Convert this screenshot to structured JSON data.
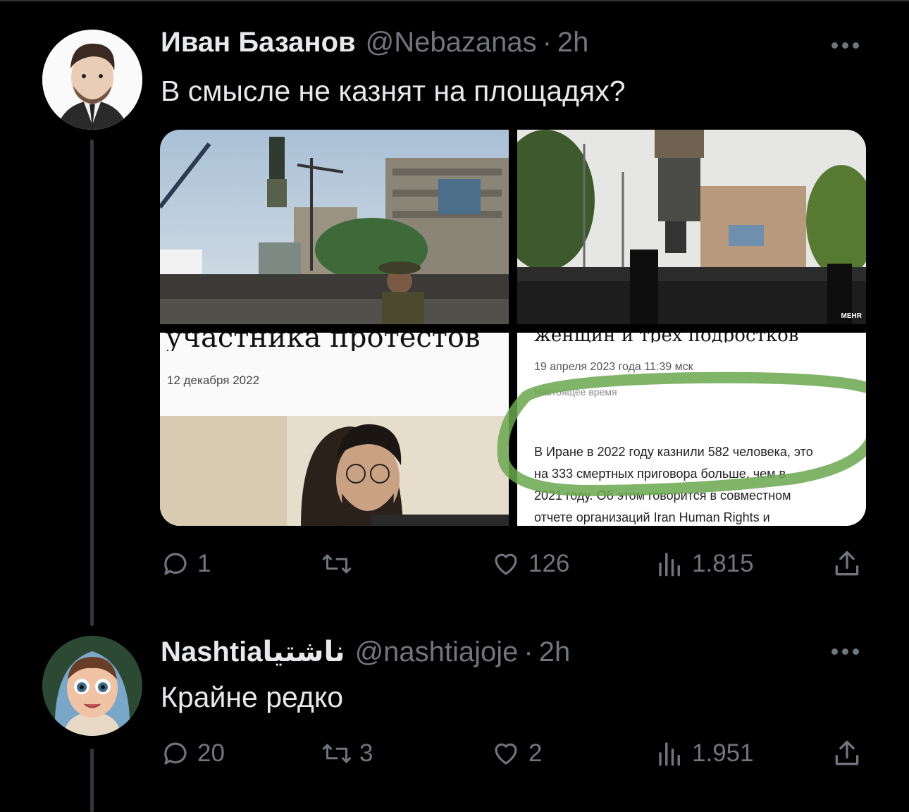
{
  "tweet1": {
    "display_name": "Иван Базанов",
    "handle": "@Nebazanas",
    "time": "2h",
    "text": "В смысле не казнят на площадях?",
    "media": {
      "left_date": "12 декабря 2022",
      "right_date": "19 апреля 2023 года 11:39 мск",
      "right_source": "Настоящее время",
      "right_body_lines": [
        "В Иране в 2022 году казнили 582 человека, это",
        "на 333 смертных приговора больше, чем в",
        "2021 году. Об этом говорится в совместном",
        "отчете организаций Iran Human Rights и"
      ],
      "watermark": "MEHR",
      "left_cut_headline": "участника протестов",
      "right_cut_headline": "женщин и трех подростков"
    },
    "actions": {
      "replies": "1",
      "retweets": "",
      "likes": "126",
      "views": "1.815"
    }
  },
  "tweet2": {
    "display_name": "Nashtiaناشتیا",
    "handle": "@nashtiajoje",
    "time": "2h",
    "text": "Крайне редко",
    "actions": {
      "replies": "20",
      "retweets": "3",
      "likes": "2",
      "views": "1.951"
    }
  },
  "colors": {
    "background": "#000000",
    "text_primary": "#e7e9ea",
    "text_secondary": "#71767b",
    "thread_line": "#333639",
    "highlight_marker": "#6aa84f"
  },
  "icons": [
    "more-icon",
    "reply-icon",
    "retweet-icon",
    "like-icon",
    "views-icon",
    "share-icon"
  ]
}
